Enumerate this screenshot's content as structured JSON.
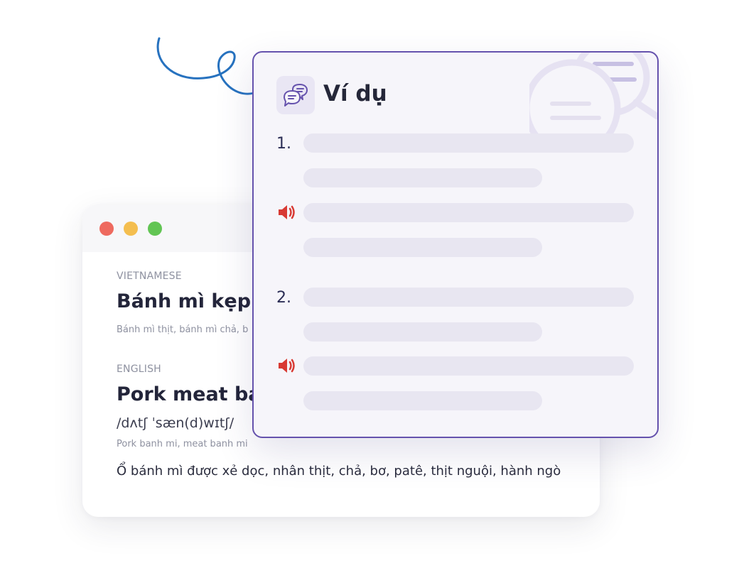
{
  "dictionary": {
    "vietnamese_label": "VIETNAMESE",
    "vietnamese_term": "Bánh mì kẹp t",
    "vietnamese_synonyms": "Bánh mì thịt, bánh mì chả, b",
    "english_label": "ENGLISH",
    "english_term": "Pork meat ba",
    "ipa": "/dʌtʃ ˈsæn(d)wɪtʃ/",
    "english_synonyms": "Pork banh mi, meat banh mi",
    "definition": "Ổ bánh mì được xẻ dọc, nhân thịt, chả, bơ, patê, thịt nguội, hành ngò"
  },
  "examples": {
    "title": "Ví dụ",
    "items": [
      {
        "number": "1."
      },
      {
        "number": "2."
      }
    ]
  },
  "colors": {
    "accent": "#6552ad",
    "speaker": "#d83a34",
    "skeleton": "#e8e6f1",
    "close_dot": "#ee6a5f",
    "minimize_dot": "#f4be4f",
    "maximize_dot": "#62c554"
  },
  "icons": {
    "header": "chat-bubbles-icon",
    "audio": "speaker-icon"
  }
}
